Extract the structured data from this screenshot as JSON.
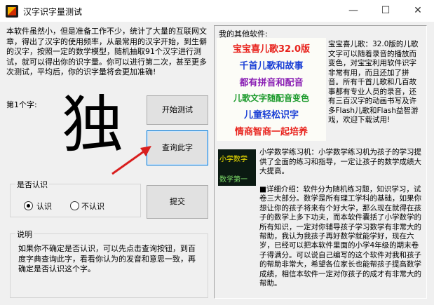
{
  "window": {
    "title": "汉字识字量测试",
    "minimize": "—",
    "maximize": "☐",
    "close": "✕"
  },
  "intro_text": "本软件虽然小，但是准备工作不少，统计了大量的互联网文章，得出了汉字的使用频率，从最常用的汉字开始，到生僻的汉字，按照一定的数学模型，随机抽取91个汉字进行测试，就可以得出你的识字量。你可以进行第二次，甚至更多次测试，平均后，你的识字量将会更加准确!",
  "current_char_label": "第1个字:",
  "current_char": "独",
  "buttons": {
    "start": "开始测试",
    "query": "查询此字",
    "submit": "提交"
  },
  "recognize_group": {
    "title": "是否认识",
    "yes": "认识",
    "no": "不认识",
    "selected": "yes"
  },
  "explain_group": {
    "title": "说明",
    "text": "如果你不确定是否认识，可以先点击查询按钮，到百度字典查询此字，看看你认为的发音和意思一致，再确定是否认识这个字。"
  },
  "other_software_label": "我的其他软件:",
  "ad_lines": [
    {
      "text": "宝宝喜儿歌32.0版",
      "color": "#e8231d"
    },
    {
      "text": "千首儿歌和故事",
      "color": "#1a3fd6"
    },
    {
      "text": "都有拼音和配音",
      "color": "#8a1fb4"
    },
    {
      "text": "儿歌文字随配音变色",
      "color": "#1e9b2e"
    },
    {
      "text": "儿童轻松识字",
      "color": "#1a3fd6"
    },
    {
      "text": "情商智商一起培养",
      "color": "#e8231d"
    }
  ],
  "baby_song_desc": "宝宝喜儿歌：32.0版的儿歌文字可以随着录音的播放而变色，对宝宝利用软件识字非常有用，而且还加了拼音。所有千首儿歌和几百故事都有专业人员的录音，还有三百汉字的动画书写及许多Flash儿歌和Flash益智游戏，欢迎下载试用!",
  "math_thumb_lines": [
    "小学数学",
    "数学第一"
  ],
  "math_desc": "小学数学练习机：小学数学练习机为孩子的学习提供了全面的练习和指导，一定让孩子的数学成绩大大提高。",
  "detail_text": "■详细介绍：软件分为随机练习题，知识学习，试卷三大部分。数学是所有理工学科的基础，如果你想让你的孩子将来有个好大学，那么现在就得在孩子的数学上多下功夫，而本软件囊括了小学数学的所有知识，一定对你辅导孩子学习数学有非常大的帮助，我认为我孩子再好数学就能学好，现在六岁，已经可以把本软件里面的小学4年级的期末卷子得满分。可以说自己编写的这个软件对我和孩子的帮助非常大，希望各位家长也能帮孩子提高数学成绩，相信本软件一定对你孩子的成才有非常大的帮助。"
}
